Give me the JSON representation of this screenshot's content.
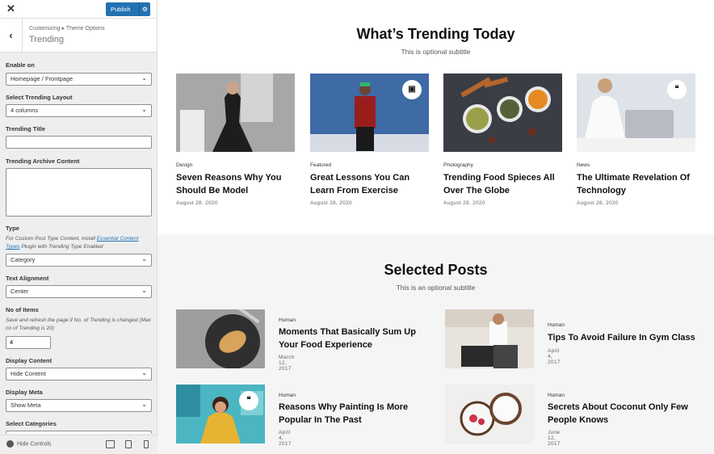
{
  "customizer": {
    "close_glyph": "✕",
    "publish_label": "Publish",
    "gear_glyph": "⚙",
    "back_glyph": "‹",
    "breadcrumb": "Customizing ▸ Theme Options",
    "section_title": "Trending",
    "controls": {
      "enable_on_label": "Enable on",
      "enable_on_value": "Homepage / Frontpage",
      "layout_label": "Select Trending Layout",
      "layout_value": "4 columns",
      "title_label": "Trending Title",
      "archive_label": "Trending Archive Content",
      "type_label": "Type",
      "type_desc_1": "For Custom Post Type Content, install",
      "type_desc_link": "Essential Content Types",
      "type_desc_2": "Plugin with Trending Type Enabled",
      "type_value": "Category",
      "align_label": "Text Alignment",
      "align_value": "Center",
      "items_label": "No of Items",
      "items_desc": "Save and refresh the page if No. of Trending is changed (Max no of Trending is 20)",
      "items_value": "4",
      "display_content_label": "Display Content",
      "display_content_value": "Hide Content",
      "display_meta_label": "Display Meta",
      "display_meta_value": "Show Meta",
      "categories_label": "Select Categories"
    },
    "footer": {
      "hide_controls": "Hide Controls"
    }
  },
  "trending": {
    "title": "What’s Trending Today",
    "subtitle": "This is optional subtitle",
    "cards": [
      {
        "category": "Design",
        "title": "Seven Reasons Why You Should Be Model",
        "date": "August 28, 2020"
      },
      {
        "category": "Featured",
        "title": "Great Lessons You Can Learn From Exercise",
        "date": "August 28, 2020",
        "badge": "image-icon"
      },
      {
        "category": "Photography",
        "title": "Trending Food Spieces All Over The Globe",
        "date": "August 28, 2020"
      },
      {
        "category": "News",
        "title": "The Ultimate Revelation Of Technology",
        "date": "August 28, 2020",
        "badge": "quote-icon"
      }
    ]
  },
  "selected": {
    "title": "Selected Posts",
    "subtitle": "This is an optional subtitle",
    "posts": [
      {
        "category": "Human",
        "title": "Moments That Basically Sum Up Your Food Experience",
        "date": "March 12, 2017"
      },
      {
        "category": "Human",
        "title": "Tips To Avoid Failure In Gym Class",
        "date": "April 4, 2017"
      },
      {
        "category": "Human",
        "title": "Reasons Why Painting Is More Popular In The Past",
        "date": "April 4, 2017",
        "badge": "quote-icon"
      },
      {
        "category": "Human",
        "title": "Secrets About Coconut Only Few People Knows",
        "date": "June 12, 2017"
      }
    ]
  },
  "colors": {
    "accent": "#2271b1",
    "panel_bg": "#eeeeee",
    "section_bg": "#f5f5f5"
  }
}
